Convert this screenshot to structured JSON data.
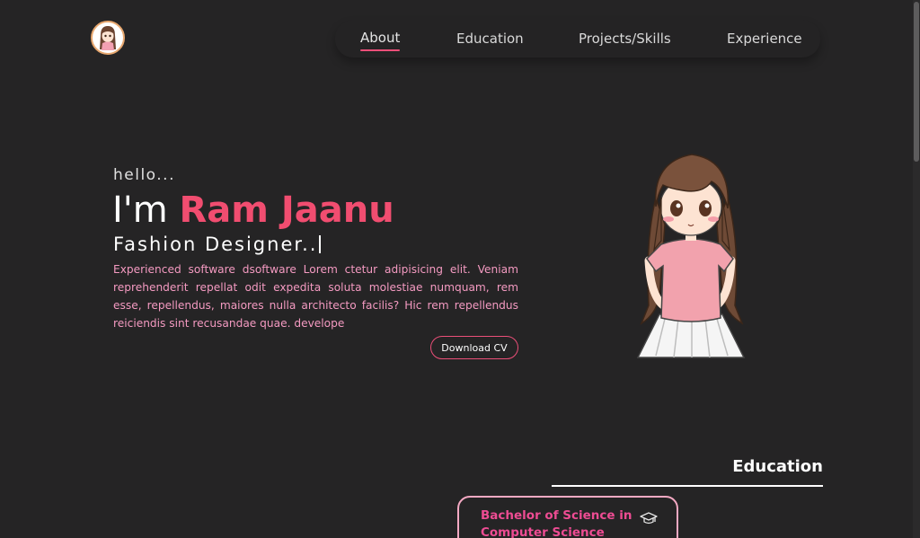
{
  "header": {
    "logo_icon": "avatar-logo-icon",
    "nav": [
      {
        "label": "About",
        "active": true
      },
      {
        "label": "Education",
        "active": false
      },
      {
        "label": "Projects/Skills",
        "active": false
      },
      {
        "label": "Experience",
        "active": false
      }
    ]
  },
  "hero": {
    "greeting": "hello...",
    "intro_prefix": "I'm ",
    "name": "Ram Jaanu",
    "role": "Fashion Designer..",
    "bio": "Experienced software dsoftware Lorem ctetur adipisicing elit. Veniam reprehenderit repellat odit expedita soluta molestiae numquam, rem esse, repellendus, maiores nulla architecto facilis? Hic rem repellendus reiciendis sint recusandae quae. develope",
    "cv_button": "Download CV",
    "illustration_icon": "cartoon-girl-illustration"
  },
  "education": {
    "title": "Education",
    "items": [
      {
        "degree": "Bachelor of Science in Computer Science",
        "icon": "graduation-cap-icon"
      }
    ]
  },
  "colors": {
    "background": "#252425",
    "accent": "#f14d70",
    "bio_text": "#f49ac1",
    "degree_text": "#ee4c93"
  }
}
